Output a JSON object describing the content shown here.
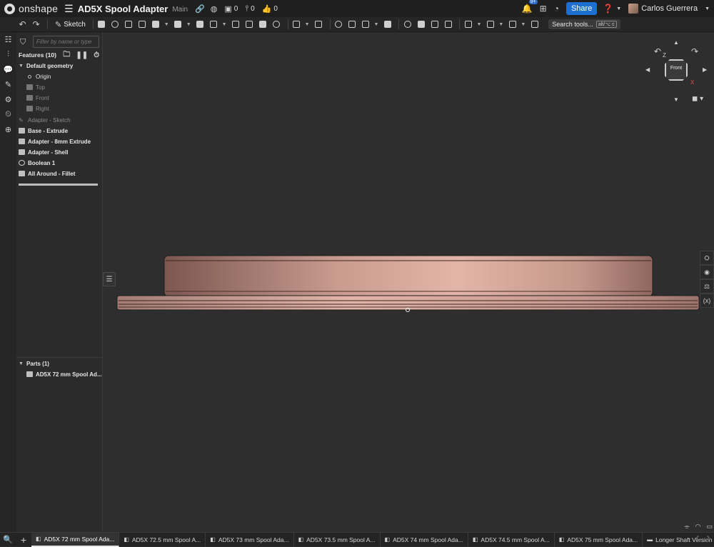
{
  "app": {
    "brand": "onshape"
  },
  "document": {
    "title": "AD5X Spool Adapter",
    "branch": "Main"
  },
  "topbar": {
    "stats": [
      {
        "icon": "versions-icon",
        "value": "0"
      },
      {
        "icon": "branch-icon",
        "value": "0"
      },
      {
        "icon": "like-icon",
        "value": "0"
      }
    ],
    "notification_badge": "9+",
    "share_label": "Share",
    "user_name": "Carlos Guerrera"
  },
  "toolbar": {
    "sketch_label": "Sketch",
    "search_label": "Search tools...",
    "search_shortcut": "alt/⌥ c"
  },
  "feature_panel": {
    "filter_placeholder": "Filter by name or type",
    "features_header": "Features (10)",
    "default_geometry_label": "Default geometry",
    "default_geometry_items": [
      "Origin",
      "Top",
      "Front",
      "Right"
    ],
    "features": [
      {
        "label": "Adapter - Sketch",
        "kind": "sketch"
      },
      {
        "label": "Base - Extrude",
        "kind": "extrude"
      },
      {
        "label": "Adapter - 8mm Extrude",
        "kind": "extrude"
      },
      {
        "label": "Adapter - Shell",
        "kind": "shell"
      },
      {
        "label": "Boolean 1",
        "kind": "boolean"
      },
      {
        "label": "All Around - Fillet",
        "kind": "fillet"
      }
    ],
    "parts_header": "Parts (1)",
    "parts": [
      "AD5X 72 mm Spool Ad..."
    ]
  },
  "viewport": {
    "view_cube_label": "Front",
    "axis_labels": {
      "z": "Z",
      "x": "X"
    },
    "part_color_light": "#e3b5a8",
    "part_color_dark": "#7c5750"
  },
  "tabs": [
    {
      "label": "AD5X 72 mm Spool Ada...",
      "icon": "part-studio-icon",
      "active": true
    },
    {
      "label": "AD5X 72.5 mm Spool A...",
      "icon": "part-studio-icon",
      "active": false
    },
    {
      "label": "AD5X 73 mm Spool Ada...",
      "icon": "part-studio-icon",
      "active": false
    },
    {
      "label": "AD5X 73.5 mm Spool A...",
      "icon": "part-studio-icon",
      "active": false
    },
    {
      "label": "AD5X 74 mm Spool Ada...",
      "icon": "part-studio-icon",
      "active": false
    },
    {
      "label": "AD5X 74.5 mm Spool A...",
      "icon": "part-studio-icon",
      "active": false
    },
    {
      "label": "AD5X 75 mm Spool Ada...",
      "icon": "part-studio-icon",
      "active": false
    },
    {
      "label": "Longer Shaft Version",
      "icon": "folder-icon",
      "active": false
    }
  ]
}
